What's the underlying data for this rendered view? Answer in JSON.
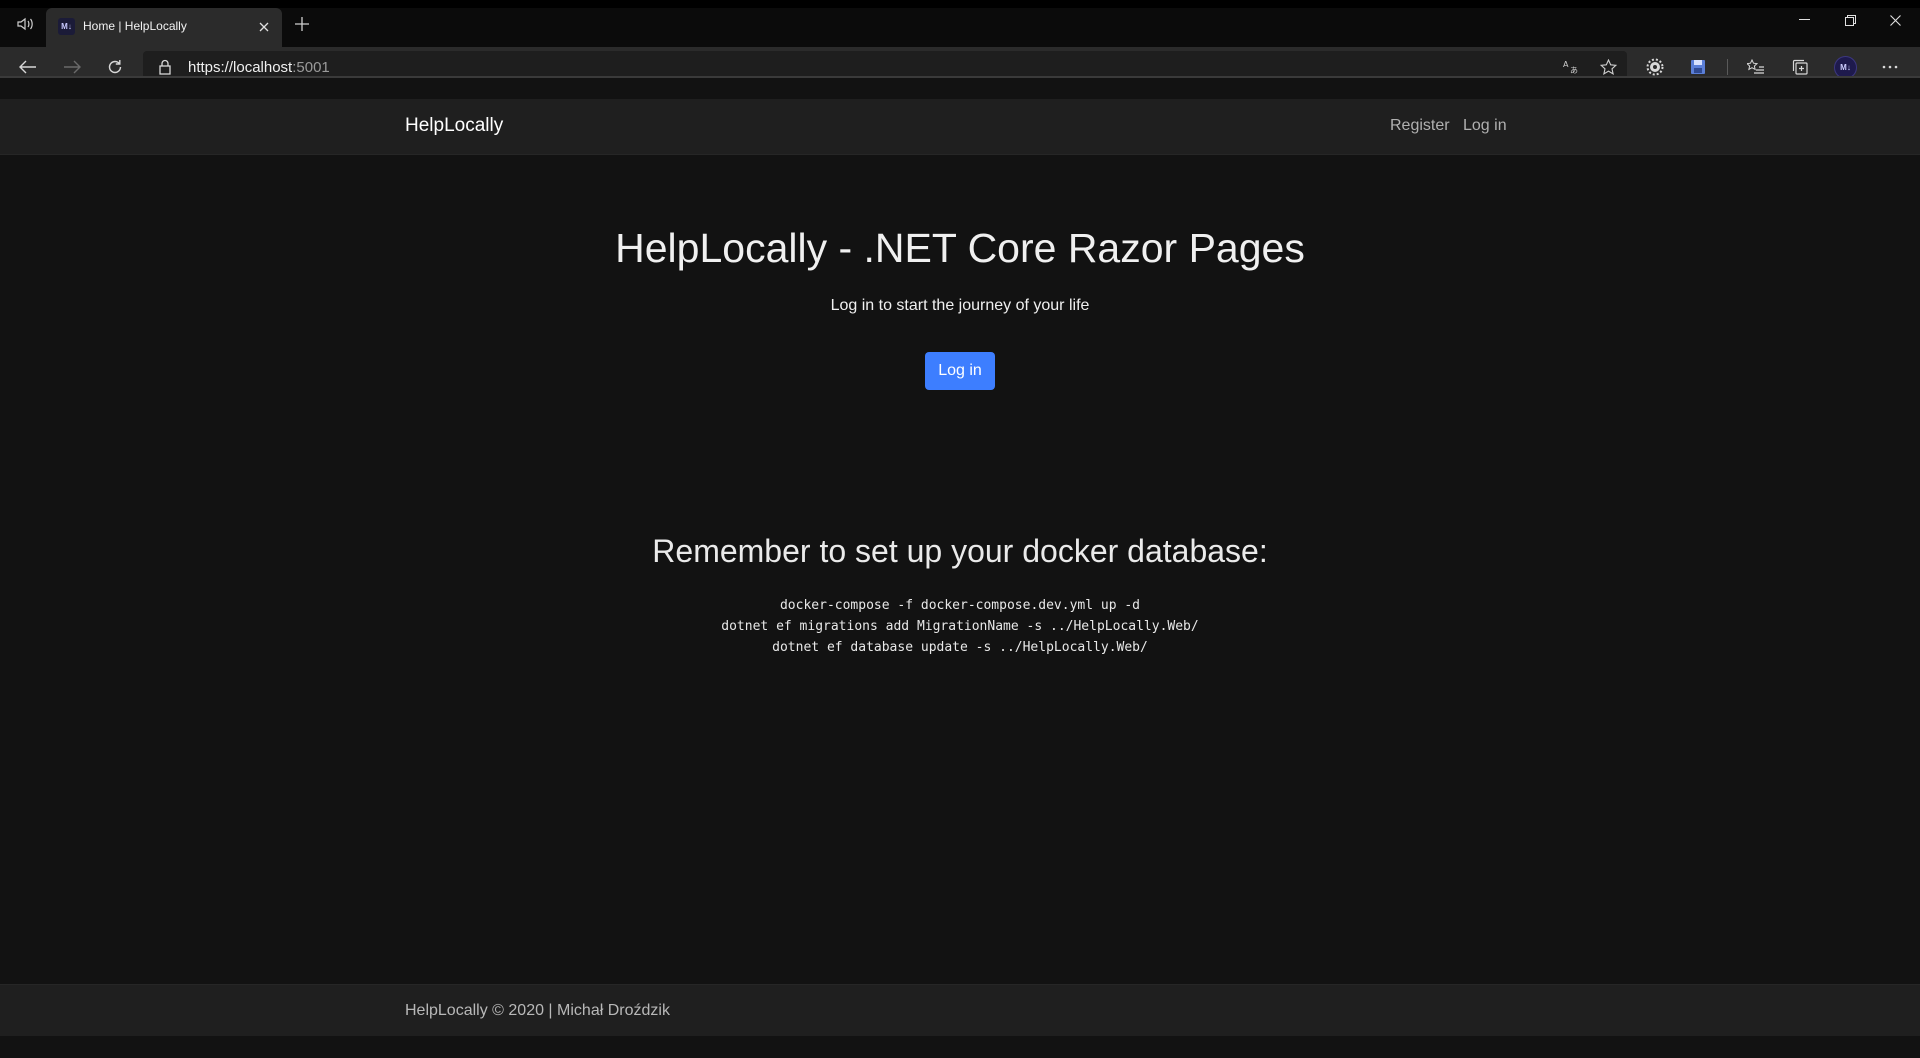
{
  "browser": {
    "tab": {
      "title": "Home | HelpLocally",
      "favicon_text": "M↓"
    },
    "address": {
      "url_main": "https://localhost",
      "url_port": ":5001"
    },
    "profile_initials": "M↓"
  },
  "site": {
    "brand": "HelpLocally",
    "nav": {
      "register": "Register",
      "login": "Log in"
    }
  },
  "hero": {
    "title": "HelpLocally - .NET Core Razor Pages",
    "lead": "Log in to start the journey of your life",
    "button": "Log in"
  },
  "docker": {
    "title": "Remember to set up your docker database:",
    "commands": [
      "docker-compose -f docker-compose.dev.yml up -d",
      "dotnet ef migrations add MigrationName -s ../HelpLocally.Web/",
      "dotnet ef database update -s ../HelpLocally.Web/"
    ]
  },
  "footer": {
    "text": "HelpLocally © 2020 | Michał Droździk"
  },
  "colors": {
    "page_bg": "#121212",
    "navbar_bg": "#1f1f1f",
    "accent": "#3d7eff"
  }
}
